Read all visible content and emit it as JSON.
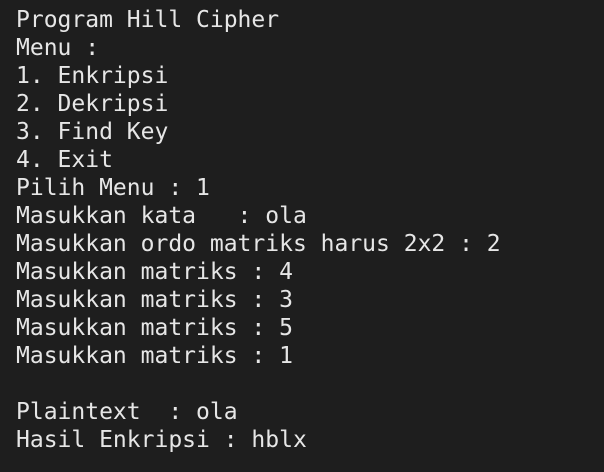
{
  "terminal": {
    "lines": [
      "Program Hill Cipher",
      "Menu :",
      "1. Enkripsi",
      "2. Dekripsi",
      "3. Find Key",
      "4. Exit",
      "Pilih Menu : 1",
      "Masukkan kata   : ola",
      "Masukkan ordo matriks harus 2x2 : 2",
      "Masukkan matriks : 4",
      "Masukkan matriks : 3",
      "Masukkan matriks : 5",
      "Masukkan matriks : 1",
      "",
      "Plaintext  : ola",
      "Hasil Enkripsi : hblx"
    ],
    "colors": {
      "background": "#1e1e1e",
      "text": "#e6e6e6"
    }
  }
}
